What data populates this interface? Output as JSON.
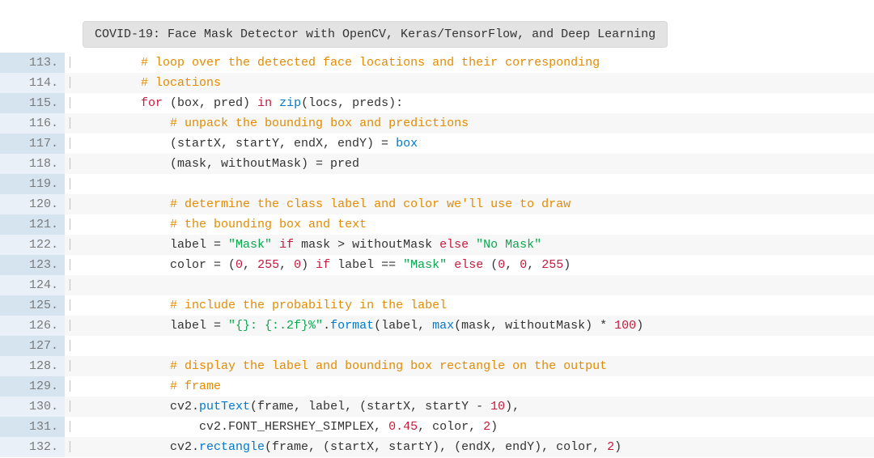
{
  "title": "COVID-19: Face Mask Detector with OpenCV, Keras/TensorFlow, and Deep Learning",
  "lines": [
    {
      "n": "113.",
      "seg": [
        {
          "t": "        ",
          "c": ""
        },
        {
          "t": "# loop over the detected face locations and their corresponding",
          "c": "tok-comment"
        }
      ]
    },
    {
      "n": "114.",
      "seg": [
        {
          "t": "        ",
          "c": ""
        },
        {
          "t": "# locations",
          "c": "tok-comment"
        }
      ]
    },
    {
      "n": "115.",
      "seg": [
        {
          "t": "        ",
          "c": ""
        },
        {
          "t": "for",
          "c": "tok-kw"
        },
        {
          "t": " (box, pred) ",
          "c": ""
        },
        {
          "t": "in",
          "c": "tok-kw"
        },
        {
          "t": " ",
          "c": ""
        },
        {
          "t": "zip",
          "c": "tok-builtin"
        },
        {
          "t": "(locs, preds):",
          "c": ""
        }
      ]
    },
    {
      "n": "116.",
      "seg": [
        {
          "t": "            ",
          "c": ""
        },
        {
          "t": "# unpack the bounding box and predictions",
          "c": "tok-comment"
        }
      ]
    },
    {
      "n": "117.",
      "seg": [
        {
          "t": "            (startX, startY, endX, endY) = ",
          "c": ""
        },
        {
          "t": "box",
          "c": "tok-builtin"
        }
      ]
    },
    {
      "n": "118.",
      "seg": [
        {
          "t": "            (mask, withoutMask) = pred",
          "c": ""
        }
      ]
    },
    {
      "n": "119.",
      "seg": [
        {
          "t": " ",
          "c": ""
        }
      ]
    },
    {
      "n": "120.",
      "seg": [
        {
          "t": "            ",
          "c": ""
        },
        {
          "t": "# determine the class label and color we'll use to draw",
          "c": "tok-comment"
        }
      ]
    },
    {
      "n": "121.",
      "seg": [
        {
          "t": "            ",
          "c": ""
        },
        {
          "t": "# the bounding box and text",
          "c": "tok-comment"
        }
      ]
    },
    {
      "n": "122.",
      "seg": [
        {
          "t": "            label = ",
          "c": ""
        },
        {
          "t": "\"Mask\"",
          "c": "tok-str"
        },
        {
          "t": " ",
          "c": ""
        },
        {
          "t": "if",
          "c": "tok-kw"
        },
        {
          "t": " mask > withoutMask ",
          "c": ""
        },
        {
          "t": "else",
          "c": "tok-kw"
        },
        {
          "t": " ",
          "c": ""
        },
        {
          "t": "\"No Mask\"",
          "c": "tok-str"
        }
      ]
    },
    {
      "n": "123.",
      "seg": [
        {
          "t": "            color = (",
          "c": ""
        },
        {
          "t": "0",
          "c": "tok-num"
        },
        {
          "t": ", ",
          "c": ""
        },
        {
          "t": "255",
          "c": "tok-num"
        },
        {
          "t": ", ",
          "c": ""
        },
        {
          "t": "0",
          "c": "tok-num"
        },
        {
          "t": ") ",
          "c": ""
        },
        {
          "t": "if",
          "c": "tok-kw"
        },
        {
          "t": " label == ",
          "c": ""
        },
        {
          "t": "\"Mask\"",
          "c": "tok-str"
        },
        {
          "t": " ",
          "c": ""
        },
        {
          "t": "else",
          "c": "tok-kw"
        },
        {
          "t": " (",
          "c": ""
        },
        {
          "t": "0",
          "c": "tok-num"
        },
        {
          "t": ", ",
          "c": ""
        },
        {
          "t": "0",
          "c": "tok-num"
        },
        {
          "t": ", ",
          "c": ""
        },
        {
          "t": "255",
          "c": "tok-num"
        },
        {
          "t": ")",
          "c": ""
        }
      ]
    },
    {
      "n": "124.",
      "seg": [
        {
          "t": " ",
          "c": ""
        }
      ]
    },
    {
      "n": "125.",
      "seg": [
        {
          "t": "            ",
          "c": ""
        },
        {
          "t": "# include the probability in the label",
          "c": "tok-comment"
        }
      ]
    },
    {
      "n": "126.",
      "seg": [
        {
          "t": "            label = ",
          "c": ""
        },
        {
          "t": "\"{}: {:.2f}%\"",
          "c": "tok-str"
        },
        {
          "t": ".",
          "c": ""
        },
        {
          "t": "format",
          "c": "tok-dot"
        },
        {
          "t": "(label, ",
          "c": ""
        },
        {
          "t": "max",
          "c": "tok-builtin"
        },
        {
          "t": "(mask, withoutMask) * ",
          "c": ""
        },
        {
          "t": "100",
          "c": "tok-num"
        },
        {
          "t": ")",
          "c": ""
        }
      ]
    },
    {
      "n": "127.",
      "seg": [
        {
          "t": " ",
          "c": ""
        }
      ]
    },
    {
      "n": "128.",
      "seg": [
        {
          "t": "            ",
          "c": ""
        },
        {
          "t": "# display the label and bounding box rectangle on the output",
          "c": "tok-comment"
        }
      ]
    },
    {
      "n": "129.",
      "seg": [
        {
          "t": "            ",
          "c": ""
        },
        {
          "t": "# frame",
          "c": "tok-comment"
        }
      ]
    },
    {
      "n": "130.",
      "seg": [
        {
          "t": "            cv2.",
          "c": ""
        },
        {
          "t": "putText",
          "c": "tok-dot"
        },
        {
          "t": "(frame, label, (startX, startY - ",
          "c": ""
        },
        {
          "t": "10",
          "c": "tok-num"
        },
        {
          "t": "),",
          "c": ""
        }
      ]
    },
    {
      "n": "131.",
      "seg": [
        {
          "t": "                cv2.FONT_HERSHEY_SIMPLEX, ",
          "c": ""
        },
        {
          "t": "0.45",
          "c": "tok-num"
        },
        {
          "t": ", color, ",
          "c": ""
        },
        {
          "t": "2",
          "c": "tok-num"
        },
        {
          "t": ")",
          "c": ""
        }
      ]
    },
    {
      "n": "132.",
      "seg": [
        {
          "t": "            cv2.",
          "c": ""
        },
        {
          "t": "rectangle",
          "c": "tok-dot"
        },
        {
          "t": "(frame, (startX, startY), (endX, endY), color, ",
          "c": ""
        },
        {
          "t": "2",
          "c": "tok-num"
        },
        {
          "t": ")",
          "c": ""
        }
      ]
    }
  ]
}
